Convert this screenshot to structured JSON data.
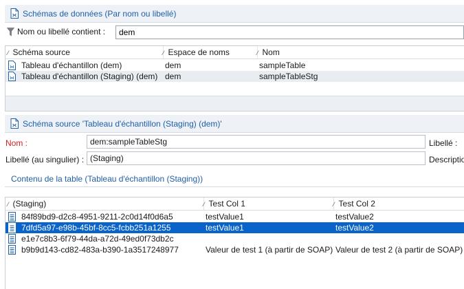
{
  "schemas_panel": {
    "title": "Schémas de données (Par nom ou libellé)",
    "filter_label": "Nom ou libellé contient :",
    "filter_value": "dem",
    "columns": [
      "Schéma source",
      "Espace de noms",
      "Nom"
    ],
    "rows": [
      {
        "label": "Tableau d'échantillon (dem)",
        "namespace": "dem",
        "name": "sampleTable"
      },
      {
        "label": "Tableau d'échantillon (Staging) (dem)",
        "namespace": "dem",
        "name": "sampleTableStg"
      }
    ]
  },
  "source_panel": {
    "title": "Schéma source 'Tableau d'échantillon (Staging) (dem)'",
    "name_label": "Nom :",
    "name_value": "dem:sampleTableStg",
    "libelle_label": "Libellé :",
    "singular_label": "Libellé (au singulier) :",
    "singular_value": "(Staging)",
    "description_label": "Descriptio",
    "content_title": "Contenu de la table (Tableau d'échantillon (Staging))",
    "table": {
      "columns": [
        "(Staging)",
        "Test Col 1",
        "Test Col 2"
      ],
      "rows": [
        {
          "id": "84f89bd9-d2c8-4951-9211-2c0d14f0d6a5",
          "col1": "testValue1",
          "col2": "testValue2"
        },
        {
          "id": "7dfd5a97-e98b-45bf-8cc5-fcbb251a1255",
          "col1": "testValue1",
          "col2": "testValue2"
        },
        {
          "id": "e1e7c8b3-6f79-44da-a72d-49ed0f73db2c",
          "col1": "",
          "col2": ""
        },
        {
          "id": "b9b9d143-cd82-483a-b390-1a3517248977",
          "col1": "Valeur de test 1 (à partir de SOAP)",
          "col2": "Valeur de test 2 (à partir de SOAP)"
        }
      ]
    }
  },
  "colors": {
    "accent": "#1f5ea8",
    "selection": "#0a63c8",
    "required_label": "#d21f1f"
  }
}
